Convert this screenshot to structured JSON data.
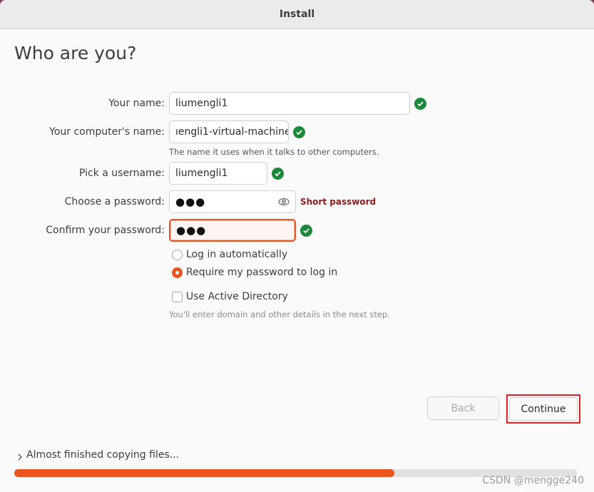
{
  "window": {
    "title": "Install"
  },
  "page": {
    "heading": "Who are you?"
  },
  "form": {
    "name": {
      "label": "Your name:",
      "value": "liumengli1"
    },
    "computer": {
      "label": "Your computer's name:",
      "value": "ıengli1-virtual-machine",
      "hint": "The name it uses when it talks to other computers."
    },
    "username": {
      "label": "Pick a username:",
      "value": "liumengli1"
    },
    "password": {
      "label": "Choose a password:",
      "value": "●●●",
      "warning": "Short password"
    },
    "confirm": {
      "label": "Confirm your password:",
      "value": "●●●"
    },
    "login_auto": {
      "label": "Log in automatically",
      "selected": false
    },
    "login_password": {
      "label": "Require my password to log in",
      "selected": true
    },
    "active_directory": {
      "label": "Use Active Directory",
      "checked": false,
      "hint": "You'll enter domain and other details in the next step."
    }
  },
  "buttons": {
    "back": "Back",
    "continue": "Continue"
  },
  "progress": {
    "label": "Almost finished copying files...",
    "fraction": 0.675
  },
  "watermark": "CSDN @mengge240",
  "colors": {
    "accent": "#e95420",
    "ok": "#1a8a3a",
    "warning": "#8b1a1a",
    "highlight": "#e02020"
  },
  "icons": {
    "ok": "check-circle-icon",
    "eye": "eye-icon",
    "expander": "chevron-right-icon"
  }
}
